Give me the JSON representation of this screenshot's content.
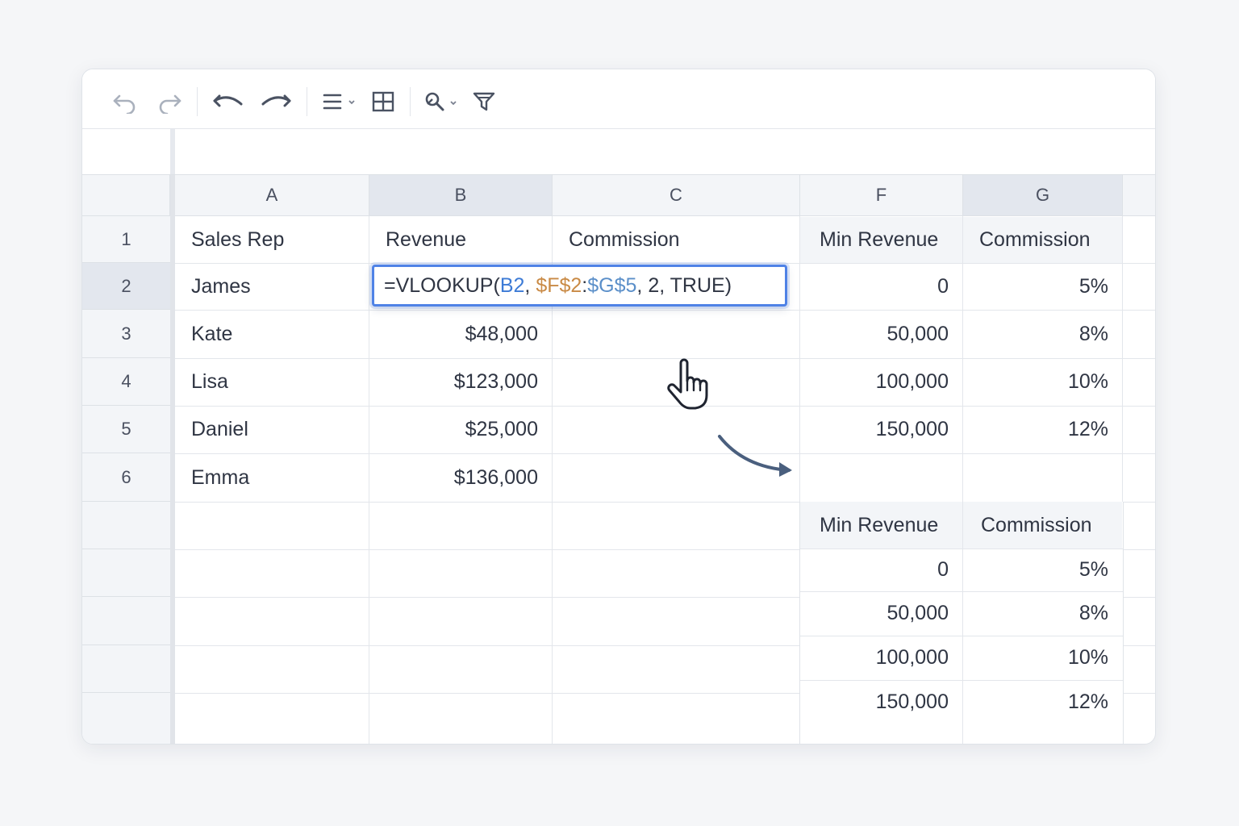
{
  "toolbar": {
    "icons": [
      "undo-icon",
      "redo-icon",
      "undo-bold-icon",
      "redo-bold-icon",
      "align-menu-icon",
      "table-grid-icon",
      "paint-tool-icon",
      "filter-icon"
    ]
  },
  "columns": [
    "A",
    "B",
    "C",
    "F",
    "G"
  ],
  "rows": [
    "1",
    "2",
    "3",
    "4",
    "5",
    "6"
  ],
  "headers": {
    "sales_rep": "Sales Rep",
    "revenue": "Revenue",
    "commission": "Commission"
  },
  "data_rows": [
    {
      "name": "James",
      "revenue": ""
    },
    {
      "name": "Kate",
      "revenue": "$48,000"
    },
    {
      "name": "Lisa",
      "revenue": "$123,000"
    },
    {
      "name": "Daniel",
      "revenue": "$25,000"
    },
    {
      "name": "Emma",
      "revenue": "$136,000"
    }
  ],
  "formula": {
    "prefix": "=VLOOKUP(",
    "ref_b": "B2",
    "sep1": ", ",
    "ref_f": "$F$2",
    "colon": ":",
    "ref_g": "$G$5",
    "suffix": ", 2, TRUE)"
  },
  "lookup_table": {
    "headers": {
      "min_revenue": "Min Revenue",
      "commission": "Commission"
    },
    "rows": [
      {
        "min": "0",
        "rate": "5%"
      },
      {
        "min": "50,000",
        "rate": "8%"
      },
      {
        "min": "100,000",
        "rate": "10%"
      },
      {
        "min": "150,000",
        "rate": "12%"
      }
    ]
  },
  "lookup_table_copy": {
    "headers": {
      "min_revenue": "Min Revenue",
      "commission": "Commission"
    },
    "rows": [
      {
        "min": "0",
        "rate": "5%"
      },
      {
        "min": "50,000",
        "rate": "8%"
      },
      {
        "min": "100,000",
        "rate": "10%"
      },
      {
        "min": "150,000",
        "rate": "12%"
      }
    ]
  },
  "colors": {
    "accent": "#4f82e6",
    "ref_b": "#3d7bd6",
    "ref_f": "#c98a45",
    "ref_g": "#5b8fc9",
    "arrow": "#4a5f7e"
  }
}
